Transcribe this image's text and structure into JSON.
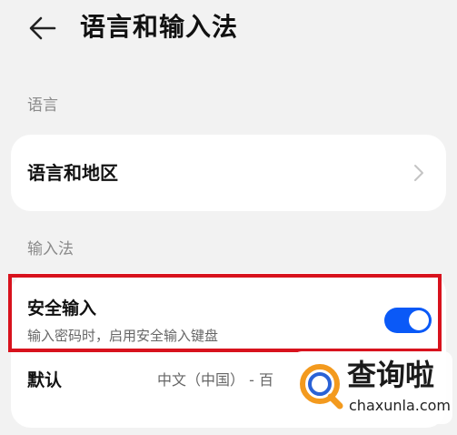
{
  "header": {
    "title": "语言和输入法",
    "back_icon": "back-arrow-icon"
  },
  "sections": {
    "language_label": "语言",
    "input_label": "输入法"
  },
  "language_card": {
    "item_label": "语言和地区",
    "chevron_icon": "chevron-right-icon"
  },
  "input_card": {
    "secure_input": {
      "title": "安全输入",
      "description": "输入密码时，启用安全输入键盘",
      "toggle_on": true
    },
    "default": {
      "label": "默认",
      "value": "中文（中国） - 百"
    }
  },
  "watermark": {
    "cn": "查询啦",
    "en": "chaxunla.com"
  },
  "colors": {
    "background": "#f2f2f2",
    "toggle_on": "#0a59f7",
    "highlight": "#d8121d",
    "watermark_orange": "#f39a1e"
  }
}
